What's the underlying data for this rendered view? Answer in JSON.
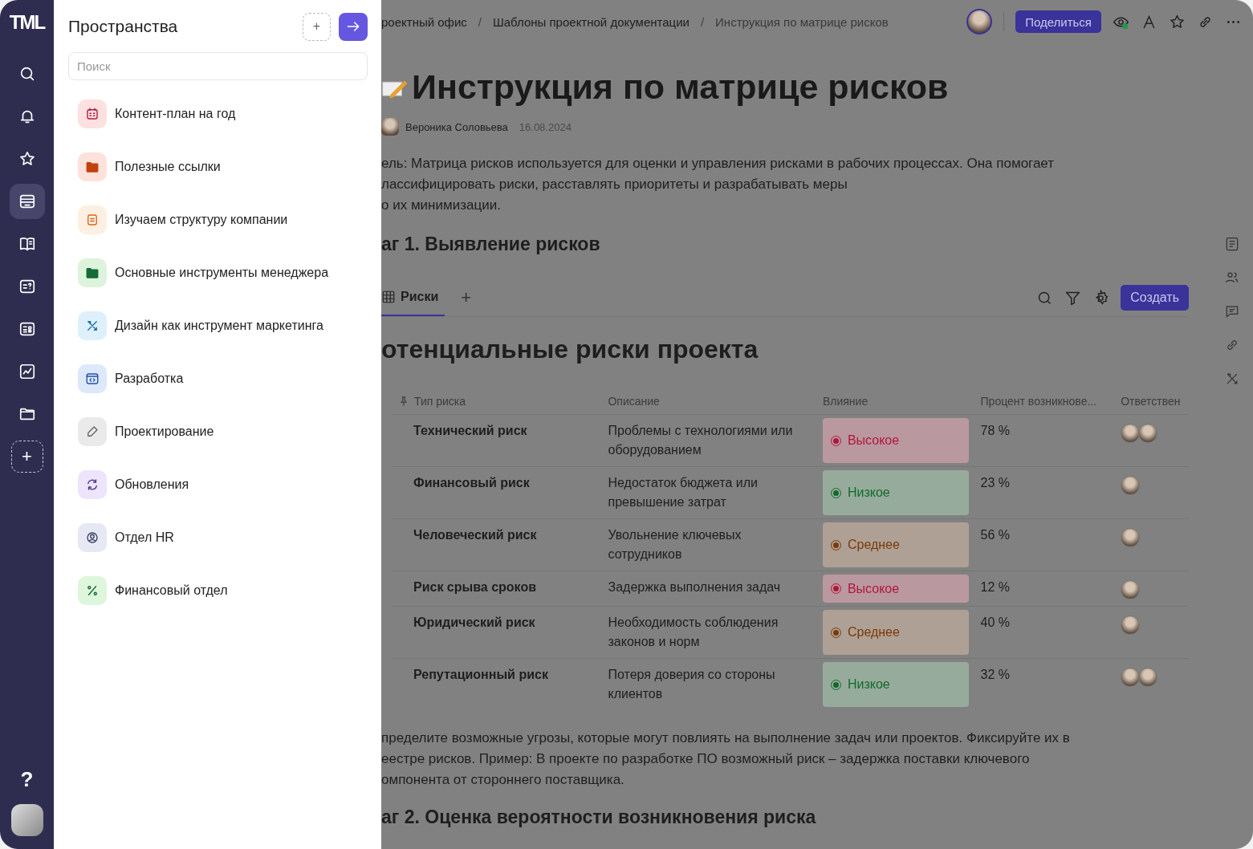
{
  "rail": {
    "logo": "TML",
    "items": [
      {
        "kind": "search",
        "selected": false
      },
      {
        "kind": "bell",
        "selected": false
      },
      {
        "kind": "star",
        "selected": false
      },
      {
        "kind": "spaces",
        "selected": true
      },
      {
        "kind": "book",
        "selected": false
      },
      {
        "kind": "quiz",
        "selected": false
      },
      {
        "kind": "board",
        "selected": false
      },
      {
        "kind": "chart",
        "selected": false
      },
      {
        "kind": "folder",
        "selected": false
      }
    ],
    "add": "+",
    "help": "?"
  },
  "panel": {
    "title": "Пространства",
    "add": "+",
    "search": {
      "placeholder": "Поиск"
    },
    "items": [
      {
        "label": "Контент-план на год",
        "kind": "calendar",
        "color": "#fde0e0"
      },
      {
        "label": "Полезные ссылки",
        "kind": "folder",
        "color": "#fde2dc"
      },
      {
        "label": "Изучаем структуру компании",
        "kind": "doc",
        "color": "#fdf0e2"
      },
      {
        "label": "Основные инструменты менеджера",
        "kind": "folder-green",
        "color": "#ddf3dc"
      },
      {
        "label": "Дизайн как инструмент маркетинга",
        "kind": "tools",
        "color": "#ddf0fb"
      },
      {
        "label": "Разработка",
        "kind": "code",
        "color": "#dde8fb"
      },
      {
        "label": "Проектирование",
        "kind": "pencil",
        "color": "#eaeaea"
      },
      {
        "label": "Обновления",
        "kind": "sync",
        "color": "#eee4fb"
      },
      {
        "label": "Отдел HR",
        "kind": "user",
        "color": "#e6e9f3"
      },
      {
        "label": "Финансовый отдел",
        "kind": "percent",
        "color": "#def6dc"
      }
    ]
  },
  "breadcrumbs": [
    "роектный офис",
    "Шаблоны проектной документации",
    "Инструкция по матрице рисков"
  ],
  "separator": "/",
  "share": "Поделиться",
  "title": "Инструкция по матрице рисков",
  "author": "Вероника Соловьева",
  "date": "16.08.2024",
  "intro": [
    "ель: Матрица рисков используется для оценки и управления рисками в рабочих процессах. Она помогает",
    "лассифицировать риски, расставлять приоритеты и разрабатывать меры",
    "о их минимизации."
  ],
  "step1": "аг 1. Выявление рисков",
  "tabs": [
    {
      "label": "Риски",
      "selected": true
    }
  ],
  "tab_add": "+",
  "create": "Создать",
  "table": {
    "title": "отенциальные риски проекта",
    "columns": [
      "Тип риска",
      "Описание",
      "Влияние",
      "Процент возникнове...",
      "Ответствен"
    ],
    "rows": [
      {
        "type": "Технический риск",
        "description": "Проблемы с технологиями или оборудованием",
        "impact": {
          "label": "Высокое",
          "color": "#b0173a"
        },
        "percent": "78 %",
        "assignees": [
          {
            "kind": "photo"
          },
          {
            "kind": "photo"
          }
        ]
      },
      {
        "type": "Финансовый риск",
        "description": "Недостаток бюджета или превышение затрат",
        "impact": {
          "label": "Низкое",
          "color": "#116b2a"
        },
        "percent": "23 %",
        "assignees": [
          {
            "kind": "photo"
          }
        ]
      },
      {
        "type": "Человеческий риск",
        "description": "Увольнение ключевых сотрудников",
        "impact": {
          "label": "Среднее",
          "color": "#7a3a08"
        },
        "percent": "56 %",
        "assignees": [
          {
            "kind": "photo"
          }
        ]
      },
      {
        "type": "Риск срыва сроков",
        "description": "Задержка выполнения задач",
        "impact": {
          "label": "Высокое",
          "color": "#b0173a"
        },
        "percent": "12 %",
        "assignees": [
          {
            "kind": "photo"
          }
        ]
      },
      {
        "type": "Юридический риск",
        "description": "Необходимость соблюдения законов и норм",
        "impact": {
          "label": "Среднее",
          "color": "#7a3a08"
        },
        "percent": "40 %",
        "assignees": [
          {
            "kind": "photo"
          }
        ]
      },
      {
        "type": "Репутационный риск",
        "description": "Потеря доверия со стороны клиентов",
        "impact": {
          "label": "Низкое",
          "color": "#116b2a"
        },
        "percent": "32 %",
        "assignees": [
          {
            "kind": "photo"
          },
          {
            "kind": "photo"
          }
        ]
      }
    ]
  },
  "outro": [
    "пределите возможные угрозы, которые могут повлиять на выполнение задач или проектов. Фиксируйте их в",
    "еестре рисков. Пример: В проекте по разработке ПО возможный риск – задержка поставки ключевого",
    "омпонента от стороннего поставщика."
  ],
  "step2": "аг 2. Оценка вероятности возникновения риска"
}
